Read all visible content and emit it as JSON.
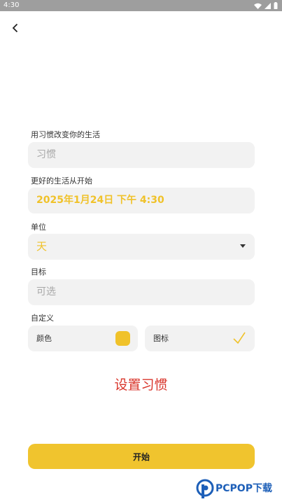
{
  "status_bar": {
    "time": "4:30"
  },
  "form": {
    "habit_label": "用习惯改变你的生活",
    "habit_placeholder": "习惯",
    "start_label": "更好的生活从开始",
    "start_datetime": "2025年1月24日 下午 4:30",
    "unit_label": "单位",
    "unit_value": "天",
    "goal_label": "目标",
    "goal_placeholder": "可选",
    "custom_label": "自定义",
    "color_label": "颜色",
    "icon_label": "图标"
  },
  "set_habit_text": "设置习惯",
  "start_button": "开始",
  "watermark": {
    "brand": "PCPOP下载"
  },
  "colors": {
    "accent": "#f0c22a",
    "set_habit": "#d9362c",
    "field_bg": "#f2f2f2"
  },
  "icons": [
    "back-arrow-icon",
    "wifi-icon",
    "signal-icon",
    "battery-icon",
    "chevron-down-icon",
    "checkmark-icon"
  ]
}
